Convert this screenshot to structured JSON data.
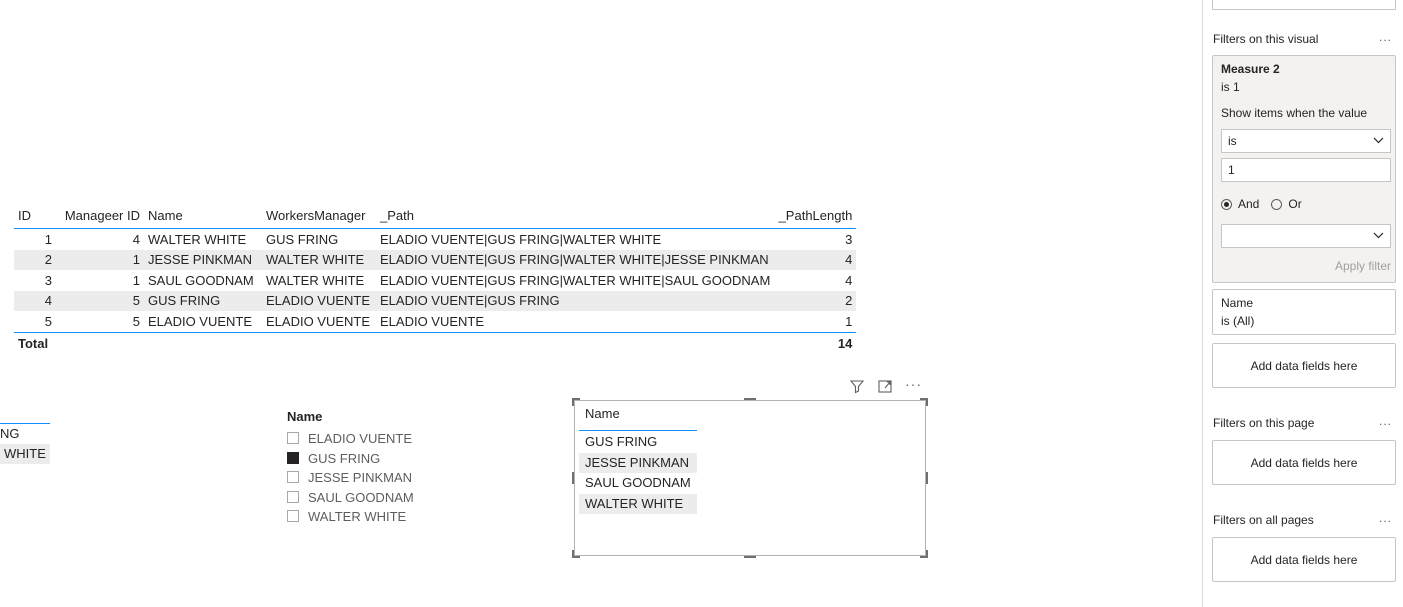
{
  "table": {
    "headers": [
      "ID",
      "Manageer ID",
      "Name",
      "WorkersManager",
      "_Path",
      "_PathLength"
    ],
    "rows": [
      [
        "1",
        "4",
        "WALTER WHITE",
        "GUS FRING",
        "ELADIO VUENTE|GUS FRING|WALTER WHITE",
        "3"
      ],
      [
        "2",
        "1",
        "JESSE PINKMAN",
        "WALTER WHITE",
        "ELADIO VUENTE|GUS FRING|WALTER WHITE|JESSE PINKMAN",
        "4"
      ],
      [
        "3",
        "1",
        "SAUL GOODNAM",
        "WALTER WHITE",
        "ELADIO VUENTE|GUS FRING|WALTER WHITE|SAUL GOODNAM",
        "4"
      ],
      [
        "4",
        "5",
        "GUS FRING",
        "ELADIO VUENTE",
        "ELADIO VUENTE|GUS FRING",
        "2"
      ],
      [
        "5",
        "5",
        "ELADIO VUENTE",
        "ELADIO VUENTE",
        "ELADIO VUENTE",
        "1"
      ]
    ],
    "total_label": "Total",
    "total_value": "14"
  },
  "clipped_list": [
    "NG",
    "WHITE"
  ],
  "slicer": {
    "title": "Name",
    "items": [
      {
        "label": "ELADIO VUENTE",
        "checked": false
      },
      {
        "label": "GUS FRING",
        "checked": true
      },
      {
        "label": "JESSE PINKMAN",
        "checked": false
      },
      {
        "label": "SAUL GOODNAM",
        "checked": false
      },
      {
        "label": "WALTER WHITE",
        "checked": false
      }
    ]
  },
  "visual": {
    "header": "Name",
    "rows": [
      "GUS FRING",
      "JESSE PINKMAN",
      "SAUL GOODNAM",
      "WALTER WHITE"
    ],
    "icons": [
      "filter-icon",
      "focus-mode-icon",
      "more-options-icon"
    ]
  },
  "filters": {
    "visual_section": "Filters on this visual",
    "more": "...",
    "measure_card": {
      "title": "Measure 2",
      "summary": "is 1",
      "show_items": "Show items when the value",
      "operator": "is",
      "value": "1",
      "and_label": "And",
      "or_label": "Or",
      "second_operator": "",
      "apply": "Apply filter"
    },
    "name_card": {
      "title": "Name",
      "summary": "is (All)"
    },
    "add_fields": "Add data fields here",
    "page_section": "Filters on this page",
    "all_pages_section": "Filters on all pages"
  },
  "colors": {
    "accent": "#118DFF",
    "row_shade": "#ececec",
    "pane_card": "#f3f2f1"
  }
}
